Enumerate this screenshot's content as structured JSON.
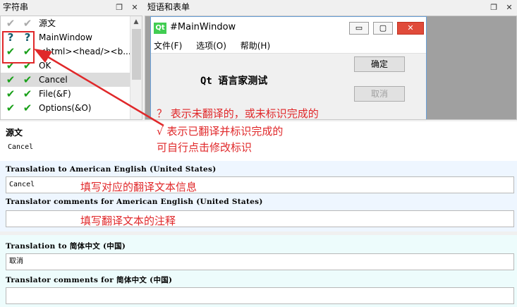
{
  "dock_left": {
    "title": "字符串",
    "float_icon": "restore-icon",
    "close_icon": "close-icon"
  },
  "dock_right": {
    "title": "短语和表单"
  },
  "strings": [
    {
      "status1": "gray-check-icon",
      "status2": "gray-check-icon",
      "text": "源文"
    },
    {
      "status1": "question-icon",
      "status2": "question-icon",
      "text": "MainWindow"
    },
    {
      "status1": "green-check-icon",
      "status2": "green-check-icon",
      "text": "<html><head/><b..."
    },
    {
      "status1": "green-check-icon",
      "status2": "green-check-icon",
      "text": "OK"
    },
    {
      "status1": "green-check-icon",
      "status2": "green-check-icon",
      "text": "Cancel",
      "selected": true
    },
    {
      "status1": "green-check-icon",
      "status2": "green-check-icon",
      "text": "File(&F)"
    },
    {
      "status1": "green-check-icon",
      "status2": "green-check-icon",
      "text": "Options(&O)"
    }
  ],
  "preview_window": {
    "logo": "Qt",
    "title": "#MainWindow",
    "menu": [
      "文件(F)",
      "选项(O)",
      "帮助(H)"
    ],
    "label": "Qt 语言家测试",
    "ok_button": "确定",
    "cancel_button": "取消"
  },
  "editor": {
    "source_header": "源文",
    "source_text": "Cancel",
    "lang_a_translation_label": "Translation to American English (United States)",
    "lang_a_translation_value": "Cancel",
    "lang_a_comments_label": "Translator comments for American English (United States)",
    "lang_a_comments_value": "",
    "lang_b_translation_label": "Translation to 简体中文 (中国)",
    "lang_b_translation_value": "取消",
    "lang_b_comments_label": "Translator comments for 简体中文 (中国)",
    "lang_b_comments_value": ""
  },
  "annotations": {
    "line1": "？ 表示未翻译的，或未标识完成的",
    "line2": "√ 表示已翻译并标识完成的",
    "line3": "可自行点击修改标识",
    "hint_translation": "填写对应的翻译文本信息",
    "hint_comments": "填写翻译文本的注释",
    "color": "#e0282a"
  }
}
